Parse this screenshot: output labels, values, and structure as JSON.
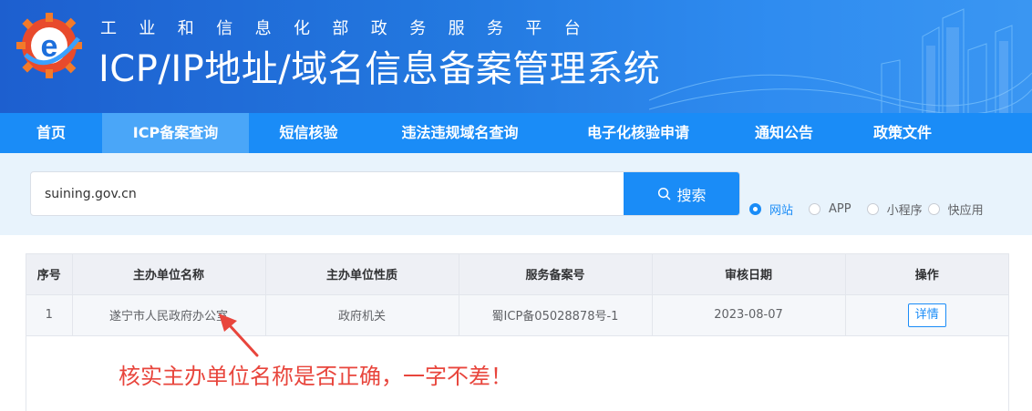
{
  "header": {
    "subtitle": "工业和信息化部政务服务平台",
    "title": "ICP/IP地址/域名信息备案管理系统"
  },
  "nav": {
    "items": [
      {
        "label": "首页",
        "active": false
      },
      {
        "label": "ICP备案查询",
        "active": true
      },
      {
        "label": "短信核验",
        "active": false
      },
      {
        "label": "违法违规域名查询",
        "active": false
      },
      {
        "label": "电子化核验申请",
        "active": false
      },
      {
        "label": "通知公告",
        "active": false
      },
      {
        "label": "政策文件",
        "active": false
      }
    ]
  },
  "search": {
    "value": "suining.gov.cn",
    "button_label": "搜索",
    "options": [
      {
        "label": "网站",
        "checked": true
      },
      {
        "label": "APP",
        "checked": false
      },
      {
        "label": "小程序",
        "checked": false
      },
      {
        "label": "快应用",
        "checked": false
      }
    ]
  },
  "table": {
    "headers": [
      "序号",
      "主办单位名称",
      "主办单位性质",
      "服务备案号",
      "审核日期",
      "操作"
    ],
    "rows": [
      {
        "index": "1",
        "name": "遂宁市人民政府办公室",
        "nature": "政府机关",
        "licence": "蜀ICP备05028878号-1",
        "date": "2023-08-07",
        "action": "详情"
      }
    ]
  },
  "annotation": {
    "text": "核实主办单位名称是否正确，一字不差！",
    "color": "#e8453c"
  },
  "colors": {
    "primary": "#1a8cf7",
    "banner": "#2379e0",
    "search_bg": "#e8f3fc"
  }
}
